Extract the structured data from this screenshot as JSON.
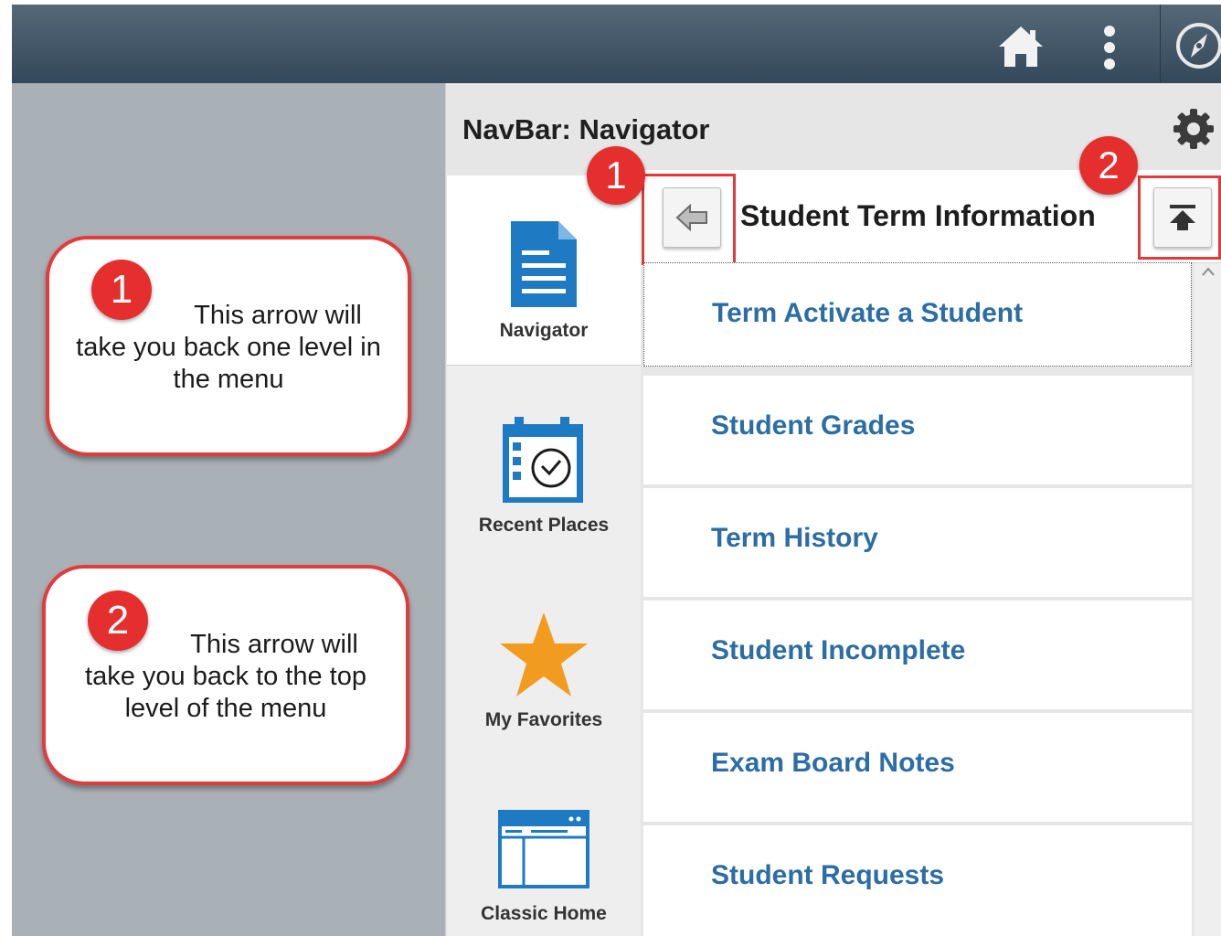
{
  "header": {
    "icons": [
      "home-icon",
      "more-vertical-icon",
      "navbar-compass-icon"
    ]
  },
  "panel": {
    "title": "NavBar: Navigator",
    "settings_icon": "gear-icon"
  },
  "nav": {
    "items": [
      {
        "label": "Navigator",
        "icon": "document-icon"
      },
      {
        "label": "Recent Places",
        "icon": "calendar-clock-icon"
      },
      {
        "label": "My Favorites",
        "icon": "star-icon"
      },
      {
        "label": "Classic Home",
        "icon": "window-icon"
      }
    ]
  },
  "breadcrumb": {
    "title": "Student Term Information",
    "back_icon": "arrow-left-icon",
    "top_icon": "arrow-to-top-icon"
  },
  "badges": {
    "one": "1",
    "two": "2"
  },
  "menu": {
    "items": [
      "Term Activate a Student",
      "Student Grades",
      "Term History",
      "Student Incomplete",
      "Exam Board Notes",
      "Student Requests"
    ]
  },
  "callouts": {
    "one": {
      "badge": "1",
      "line1": "This arrow will",
      "line2": "take you back one level in",
      "line3": "the menu"
    },
    "two": {
      "badge": "2",
      "line1": "This arrow will",
      "line2": "take you back to the top",
      "line3": "level of the menu"
    }
  },
  "colors": {
    "link": "#2c6da3",
    "accent_red": "#e52e2e",
    "header": "#3d5163",
    "favorite": "#f29c1f",
    "nav_icon": "#1f7ac4"
  }
}
